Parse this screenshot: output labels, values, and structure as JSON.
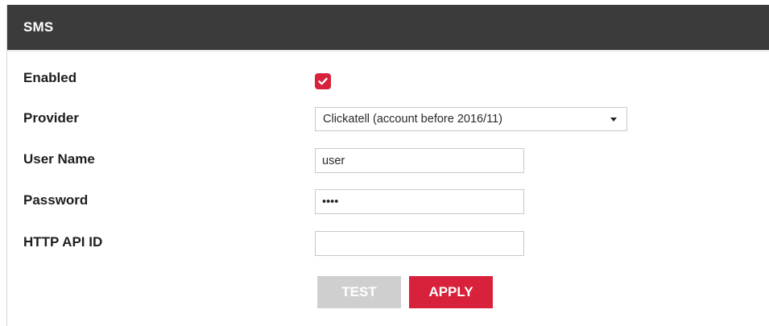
{
  "panel": {
    "title": "SMS"
  },
  "form": {
    "enabled": {
      "label": "Enabled",
      "checked": true
    },
    "provider": {
      "label": "Provider",
      "value": "Clickatell (account before 2016/11)"
    },
    "user_name": {
      "label": "User Name",
      "value": "user"
    },
    "password": {
      "label": "Password",
      "value": "••••"
    },
    "http_api_id": {
      "label": "HTTP API ID",
      "value": ""
    }
  },
  "buttons": {
    "test_label": "TEST",
    "apply_label": "APPLY"
  },
  "colors": {
    "header_bg": "#3b3b3b",
    "accent": "#d8213a",
    "disabled_button": "#cfcfcf"
  },
  "icons": {
    "checkbox": "check-icon",
    "dropdown": "caret-down-icon"
  }
}
